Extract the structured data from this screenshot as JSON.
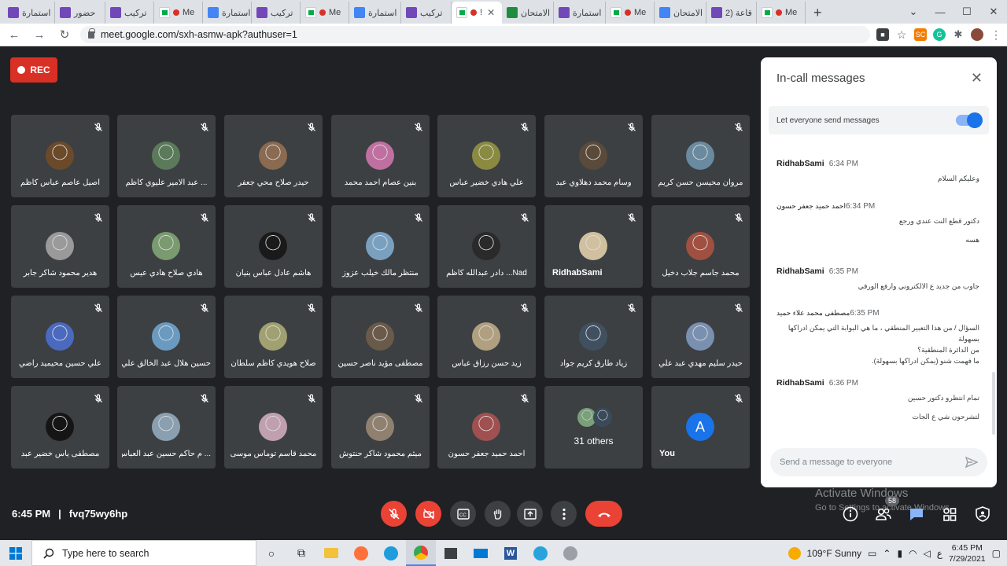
{
  "browser": {
    "tabs": [
      {
        "label": "استمارة",
        "icon": "form"
      },
      {
        "label": "حضور",
        "icon": "form"
      },
      {
        "label": "تركيب",
        "icon": "form"
      },
      {
        "label": "Me",
        "icon": "meet",
        "rec": true
      },
      {
        "label": "استمارة",
        "icon": "doc"
      },
      {
        "label": "تركيب",
        "icon": "form"
      },
      {
        "label": "Me",
        "icon": "meet",
        "rec": true
      },
      {
        "label": "استمارة",
        "icon": "doc"
      },
      {
        "label": "تركيب",
        "icon": "form"
      },
      {
        "label": "!",
        "icon": "meet",
        "rec": true,
        "active": true
      },
      {
        "label": "الامتحان",
        "icon": "class"
      },
      {
        "label": "استمارة",
        "icon": "form"
      },
      {
        "label": "Me",
        "icon": "meet",
        "rec": true
      },
      {
        "label": "الامتحان",
        "icon": "doc"
      },
      {
        "label": "قاعة (2",
        "icon": "form"
      },
      {
        "label": "Me",
        "icon": "meet",
        "rec": true
      }
    ],
    "new_tab": "+",
    "url": "meet.google.com/sxh-asmw-apk?authuser=1"
  },
  "recording": {
    "label": "REC"
  },
  "participants": [
    {
      "name": "أصيل عاصم عباس كاظم",
      "avatar": "#6b4a2a"
    },
    {
      "name": "... عبد الامير عليوي كاظم",
      "avatar": "#5a7a5a"
    },
    {
      "name": "حيدر صلاح محي جعفر",
      "avatar": "#8a6a50"
    },
    {
      "name": "بنين عصام احمد محمد",
      "avatar": "#c070a0"
    },
    {
      "name": "علي هادي خضير عباس",
      "avatar": "#8a8a40"
    },
    {
      "name": "وسام محمد دهلاوي عبد",
      "avatar": "#5a4a3a"
    },
    {
      "name": "مروان محيسن حسن كريم",
      "avatar": "#6a8aa0"
    },
    {
      "name": "هدير محمود شاكر جابر",
      "avatar": "#9a9a9a"
    },
    {
      "name": "هادي صلاح هادي عيس",
      "avatar": "#7a9a70"
    },
    {
      "name": "هاشم عادل عباس بنيان",
      "avatar": "#1a1a1a"
    },
    {
      "name": "منتظر مالك خيلب عزوز",
      "avatar": "#7aa0c0"
    },
    {
      "name": "Nad... دادر عبدالله كاظم",
      "avatar": "#2a2a2a"
    },
    {
      "name": "RidhabSami",
      "avatar": "#d0c0a0",
      "ltr": true
    },
    {
      "name": "محمد جاسم جلاب دخيل",
      "avatar": "#a05040"
    },
    {
      "name": "علي حسين محيميد راضي",
      "avatar": "#4a6ac0"
    },
    {
      "name": "حسين هلال عبد الخالق علي",
      "avatar": "#6a9ac0"
    },
    {
      "name": "صلاح هويدي كاظم سلطان",
      "avatar": "#a0a070"
    },
    {
      "name": "مصطفى مؤيد ناصر حسين",
      "avatar": "#6a5a4a"
    },
    {
      "name": "زيد حسن رزاق عباس",
      "avatar": "#b0a080"
    },
    {
      "name": "زياد طارق كريم جواد",
      "avatar": "#405060"
    },
    {
      "name": "حيدر سليم مهدي عبد علي",
      "avatar": "#7a90b0"
    },
    {
      "name": "مصطفى ياس خضير عبد",
      "avatar": "#151515"
    },
    {
      "name": "... م حاكم حسين عبد العباس",
      "avatar": "#8aa0b0"
    },
    {
      "name": "محمد قاسم توماس موسى",
      "avatar": "#c0a0b0"
    },
    {
      "name": "ميثم محمود شاكر حنتوش",
      "avatar": "#908070"
    },
    {
      "name": "احمد حميد جعفر حسون",
      "avatar": "#a05050"
    }
  ],
  "others_tile": {
    "label": "31 others"
  },
  "self_tile": {
    "label": "You",
    "initial": "A"
  },
  "chat": {
    "title": "In-call messages",
    "permission_label": "Let everyone send messages",
    "messages": [
      {
        "sender": "RidhabSami",
        "time": "6:34 PM",
        "lines": [
          "وعليكم السلام"
        ]
      },
      {
        "sender": "احمد حميد جعفر حسون",
        "time": "6:34 PM",
        "lines": [
          "دكتور قطع النت عندي ورجع",
          "هسه"
        ]
      },
      {
        "sender": "RidhabSami",
        "time": "6:35 PM",
        "lines": [
          "جاوب من جديد ع الالكتروني وارفع الورقي"
        ]
      },
      {
        "sender": "مصطفى محمد علاء حميد",
        "time": "6:35 PM",
        "lines": [
          "السؤال / من هذا التعبير المنطقي ، ما هي البوابة التي يمكن ادراكها بسهولة",
          "من الدائرة المنطقية؟",
          "ما فهمت شنو (يمكن ادراكها بسهولة)."
        ]
      },
      {
        "sender": "RidhabSami",
        "time": "6:36 PM",
        "lines": [
          "تمام انتظرو دكتور حسين",
          "لتشرحون شي ع الجات"
        ]
      }
    ],
    "input_placeholder": "Send a message to everyone"
  },
  "meeting": {
    "time": "6:45 PM",
    "separator": "|",
    "code": "fvq75wy6hp"
  },
  "participants_badge": "58",
  "watermark": {
    "line1": "Activate Windows",
    "line2": "Go to Settings to activate Windows."
  },
  "taskbar": {
    "search_placeholder": "Type here to search",
    "weather": "109°F  Sunny",
    "lang": "ع",
    "time": "6:45 PM",
    "date": "7/29/2021"
  },
  "colors": {
    "meet_red": "#ea4335",
    "accent_blue": "#1a73e8",
    "tile_bg": "#3c4043",
    "bg": "#202124"
  }
}
